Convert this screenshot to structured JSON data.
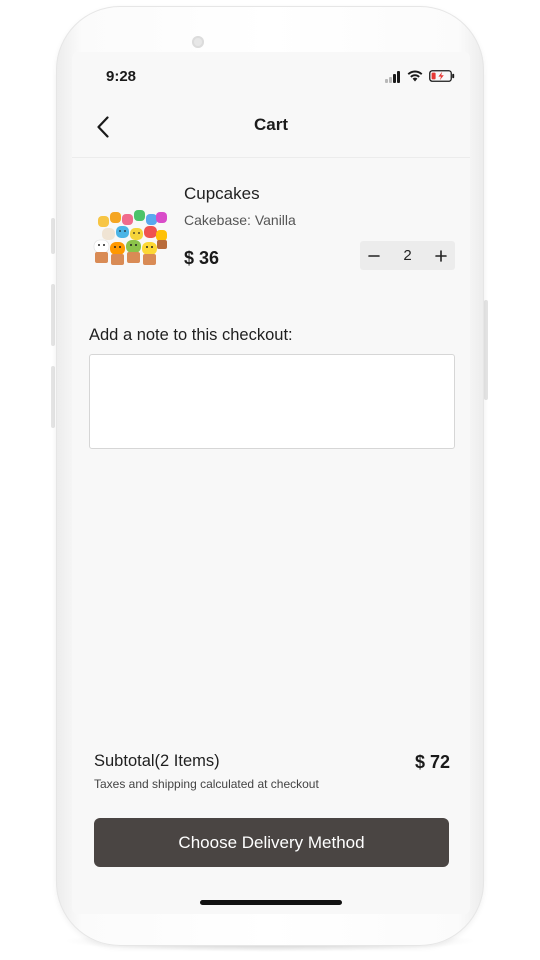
{
  "status_bar": {
    "time": "9:28",
    "battery_color": "#e53935"
  },
  "nav": {
    "title": "Cart",
    "back_icon": "chevron-left-icon"
  },
  "cart_item": {
    "name": "Cupcakes",
    "variant": "Cakebase: Vanilla",
    "price": "$ 36",
    "quantity": "2",
    "decrease_label": "−",
    "increase_label": "+",
    "image_alt": "cupcakes-image"
  },
  "note": {
    "label": "Add a note to this checkout:",
    "value": "",
    "placeholder": ""
  },
  "summary": {
    "subtotal_label": "Subtotal(2 Items)",
    "subtotal_value": "$ 72",
    "tax_note": "Taxes and shipping calculated at checkout"
  },
  "actions": {
    "primary_label": "Choose Delivery Method",
    "primary_color": "#4a4543"
  }
}
